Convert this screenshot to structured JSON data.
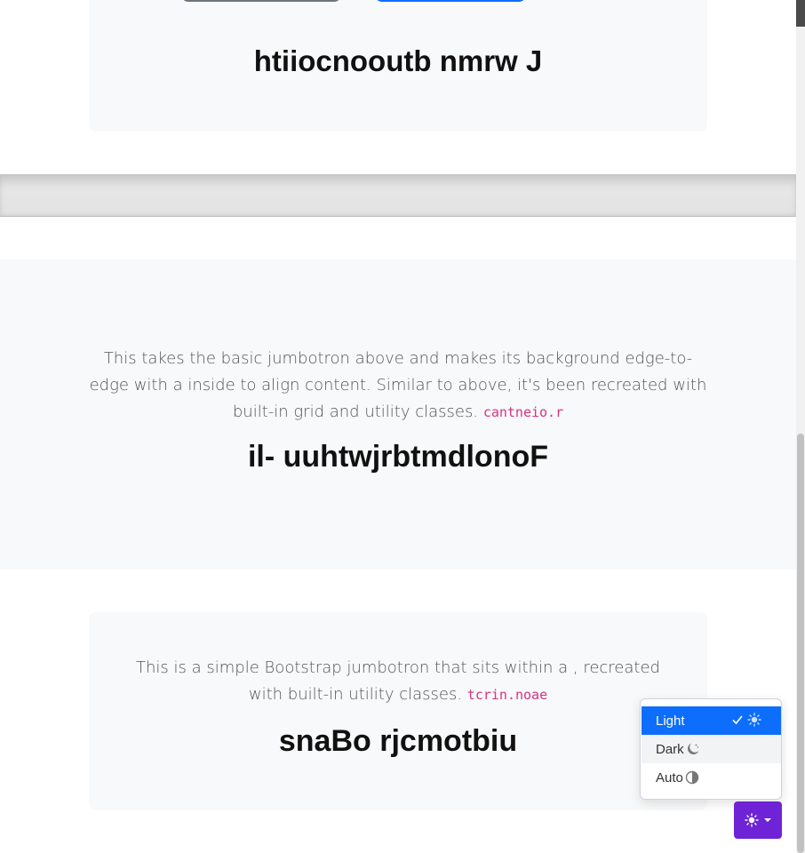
{
  "top_jumbotron": {
    "title": "htiiocnooutb nmrw J"
  },
  "fluid_jumbotron": {
    "lead": "This takes the basic jumbotron above and makes its background edge-to-edge with a inside to align content. Similar to above, it's been recreated with built-in grid and utility classes.",
    "code": "cantneio.r",
    "title": "il- uuhtwjrbtmdlonoF"
  },
  "contained_jumbotron": {
    "lead": "This is a simple Bootstrap jumbotron that sits within a , recreated with built-in utility classes.",
    "code": "tcrin.noae",
    "title": "snaBo rjcmotbiu"
  },
  "theme_menu": {
    "items": [
      {
        "label": "Light",
        "icon": "sun-icon",
        "selected": true
      },
      {
        "label": "Dark",
        "icon": "moon-stars-icon",
        "selected": false
      },
      {
        "label": "Auto",
        "icon": "half-circle-icon",
        "selected": false
      }
    ],
    "toggle_icon": "sun-icon",
    "accent_color": "#0d6efd",
    "toggle_color": "#6f23d6"
  }
}
